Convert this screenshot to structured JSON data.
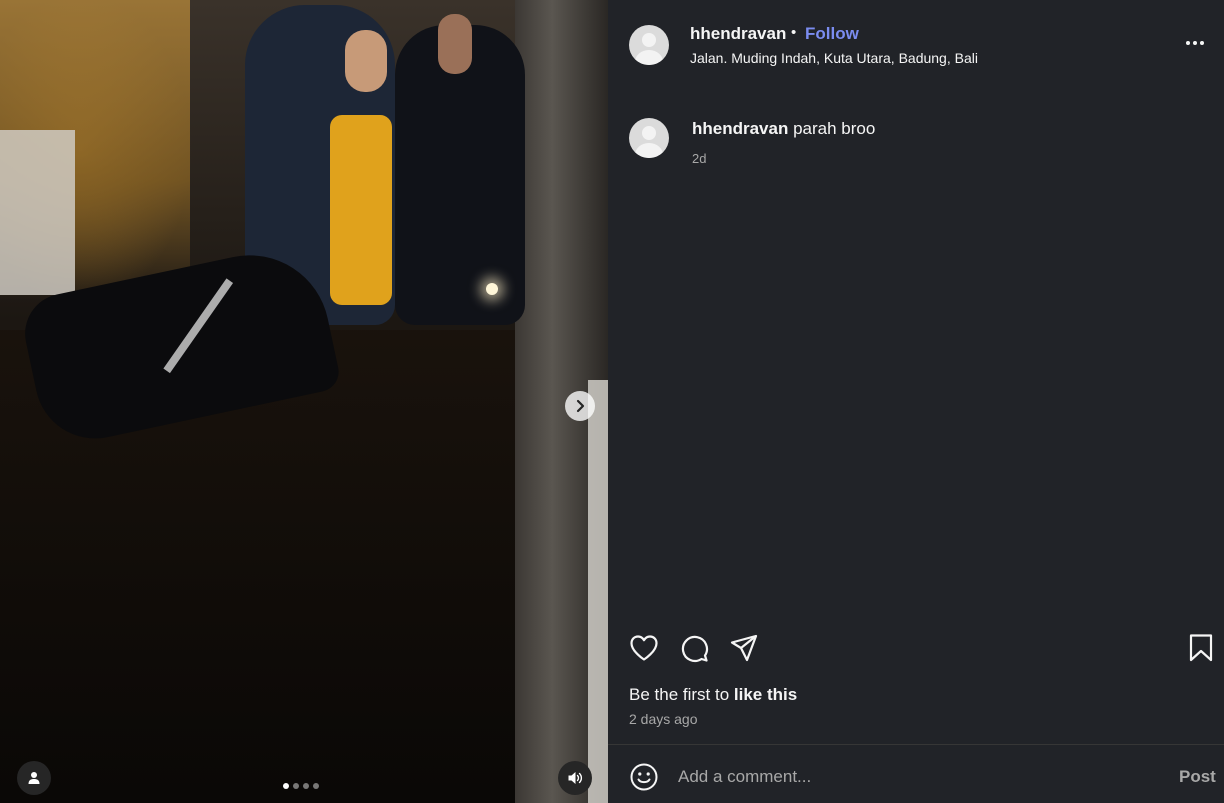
{
  "post": {
    "username": "hhendravan",
    "separator": "•",
    "follow_label": "Follow",
    "location": "Jalan. Muding Indah, Kuta Utara, Badung, Bali",
    "more_icon": "more-horizontal-icon"
  },
  "media": {
    "slide_count": 4,
    "active_slide": 1,
    "next_icon": "chevron-right-icon",
    "tags_icon": "user-tag-icon",
    "audio_icon": "speaker-icon"
  },
  "comments": [
    {
      "username": "hhendravan",
      "text": "parah broo",
      "time": "2d"
    }
  ],
  "actions": {
    "like_icon": "heart-icon",
    "comment_icon": "comment-bubble-icon",
    "share_icon": "send-icon",
    "save_icon": "bookmark-icon"
  },
  "likes": {
    "prefix": "Be the first to",
    "action": "like this"
  },
  "posted_time": "2 days ago",
  "composer": {
    "emoji_icon": "smiley-icon",
    "placeholder": "Add a comment...",
    "post_label": "Post"
  },
  "colors": {
    "panel_bg": "#212328",
    "follow_link": "#7b8cf0",
    "muted_text": "#a8a8a8"
  }
}
